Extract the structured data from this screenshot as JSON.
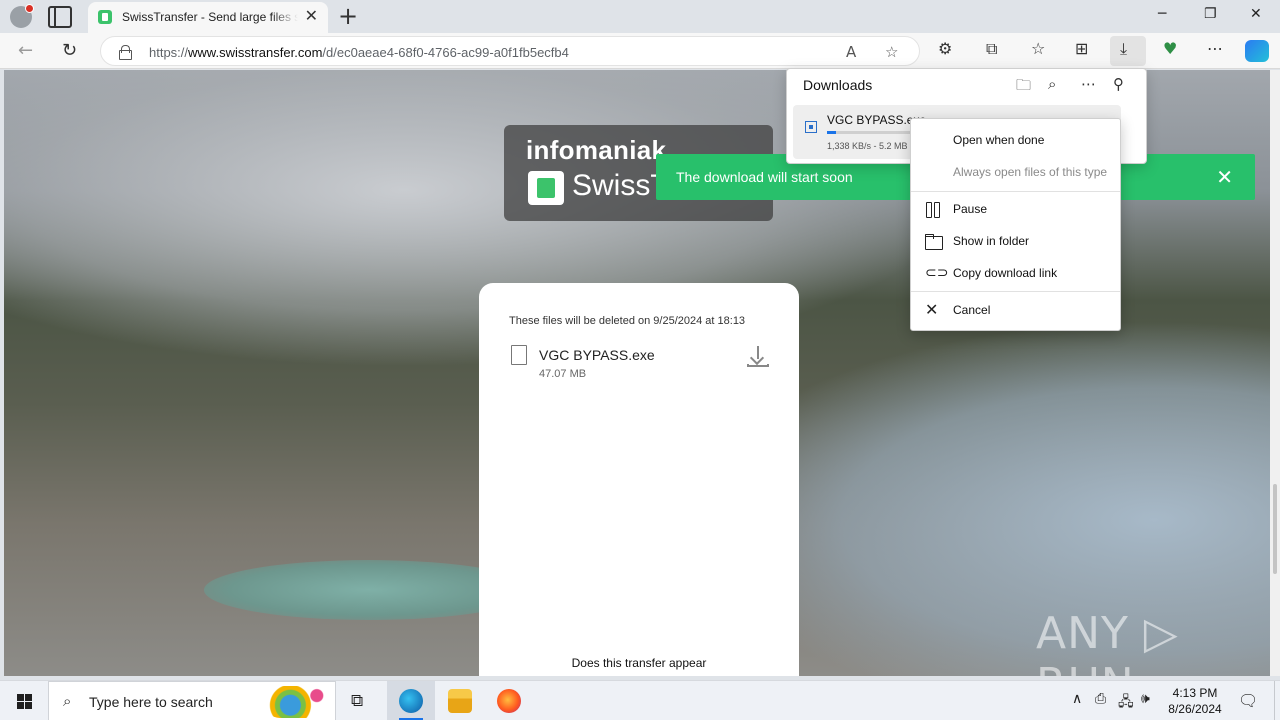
{
  "browser": {
    "tab_title": "SwissTransfer - Send large files se",
    "url_prefix": "https://",
    "url_host": "www.swisstransfer.com",
    "url_path": "/d/ec0aeae4-68f0-4766-ac99-a0f1fb5ecfb4",
    "icons": {
      "newtab": "+",
      "minimize": "─",
      "maximize": "❐",
      "close": "✕",
      "back": "←",
      "reload": "↻",
      "read_aloud": "A",
      "favorite": "☆",
      "extensions": "⚙",
      "split": "⧉",
      "favorites": "☆",
      "collections": "⊞",
      "download": "⤓",
      "performance": "♥",
      "more": "⋯"
    }
  },
  "page": {
    "brand_top": "infomaniak",
    "brand_name": "SwissTransfer",
    "toast_text": "The download will start soon",
    "toast_close": "✕",
    "deletion_note": "These files will be deleted on 9/25/2024 at 18:13",
    "file_name": "VGC BYPASS.exe",
    "file_size": "47.07 MB",
    "bottom_text": "Does this transfer appear",
    "watermark": "ANY ▷ RUN"
  },
  "downloads": {
    "title": "Downloads",
    "icons": {
      "folder": "🗀",
      "search": "⌕",
      "more": "⋯",
      "pin": "⚲"
    },
    "item_name": "VGC BYPASS.exe",
    "item_status": "1,338 KB/s - 5.2 MB",
    "progress_fraction": 0.11
  },
  "context_menu": {
    "open_when_done": "Open when done",
    "always_open": "Always open files of this type",
    "pause": "Pause",
    "show_in_folder": "Show in folder",
    "copy_link": "Copy download link",
    "cancel": "Cancel",
    "icons": {
      "link": "⊂⊃",
      "cancel": "✕"
    }
  },
  "taskbar": {
    "search_placeholder": "Type here to search",
    "search_icon": "⌕",
    "taskview_icon": "⧉",
    "tray_chevron": "∧",
    "tray_icons": [
      "⎙",
      "🖧",
      "🕪"
    ],
    "notification_icon": "🗨",
    "time": "4:13 PM",
    "date": "8/26/2024"
  },
  "colors": {
    "accent_green": "#28c06b",
    "progress_blue": "#1a73e8"
  }
}
